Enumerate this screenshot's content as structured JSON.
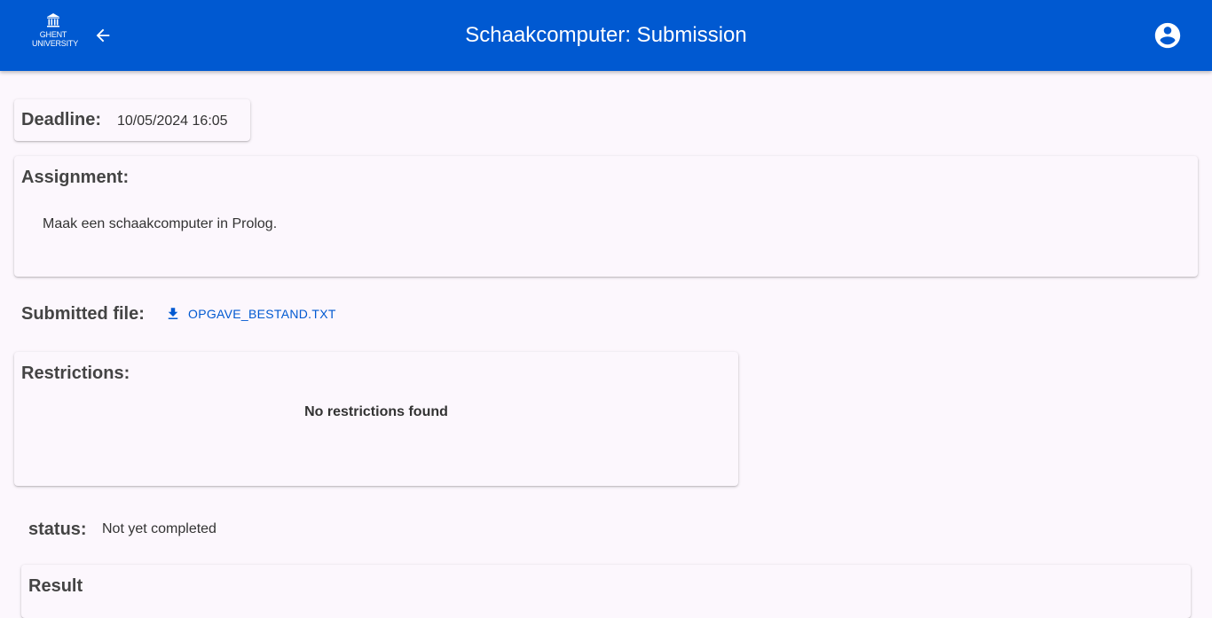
{
  "header": {
    "logo_line1": "GHENT",
    "logo_line2": "UNIVERSITY",
    "title": "Schaakcomputer: Submission",
    "back_icon": "arrow-left-icon",
    "account_icon": "account-circle-icon"
  },
  "deadline": {
    "label": "Deadline:",
    "value": "10/05/2024 16:05"
  },
  "assignment": {
    "label": "Assignment:",
    "text": "Maak een schaakcomputer in Prolog."
  },
  "submitted_file": {
    "label": "Submitted file:",
    "filename": "OPGAVE_BESTAND.TXT",
    "icon": "download-icon"
  },
  "restrictions": {
    "label": "Restrictions:",
    "empty_text": "No restrictions found"
  },
  "status": {
    "label": "status:",
    "value": "Not yet completed"
  },
  "result": {
    "label": "Result"
  },
  "colors": {
    "primary": "#0059d1",
    "background": "#fcf7fd"
  }
}
